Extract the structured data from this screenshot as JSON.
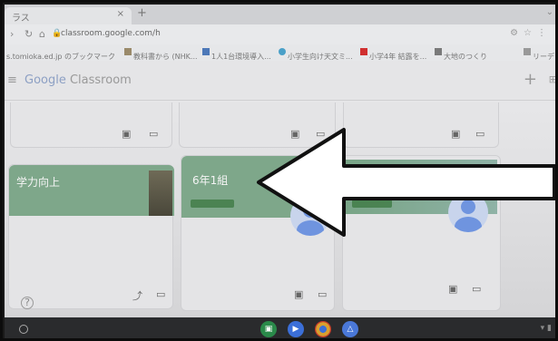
{
  "browser": {
    "tab_title": "ラス",
    "tab_close": "×",
    "new_tab": "+",
    "url": "classroom.google.com/h",
    "bookmarks": [
      {
        "label": "s.tomioka.ed.jp のブックマーク",
        "color": "#888888"
      },
      {
        "label": "教科書から (NHK...",
        "color": "#9a8a6a"
      },
      {
        "label": "1人1台環境導入...",
        "color": "#4d78b8"
      },
      {
        "label": "小学生向け天文ミ...",
        "color": "#4aa0c8"
      },
      {
        "label": "小学4年 結露を...",
        "color": "#d03030"
      },
      {
        "label": "大地のつくり",
        "color": "#7a7a7a"
      },
      {
        "label": "リーデ",
        "color": "#999999"
      }
    ]
  },
  "classroom": {
    "logo_google": "Google",
    "logo_classroom": " Classroom",
    "plus_label": "+",
    "cards": [
      {
        "name": "学力向上"
      },
      {
        "name": "6年1組"
      },
      {
        "name": ""
      }
    ]
  },
  "shelf": {
    "apps": [
      {
        "name": "classroom-app",
        "color": "#2a8a4a"
      },
      {
        "name": "meet-app",
        "color": "#3b6fd8"
      },
      {
        "name": "chrome-app",
        "color": "#d8a030"
      },
      {
        "name": "drive-app",
        "color": "#4a78d8"
      }
    ]
  },
  "colors": {
    "card_band": "#7ea78a",
    "arrow_fill": "#ffffff",
    "arrow_stroke": "#111111"
  }
}
